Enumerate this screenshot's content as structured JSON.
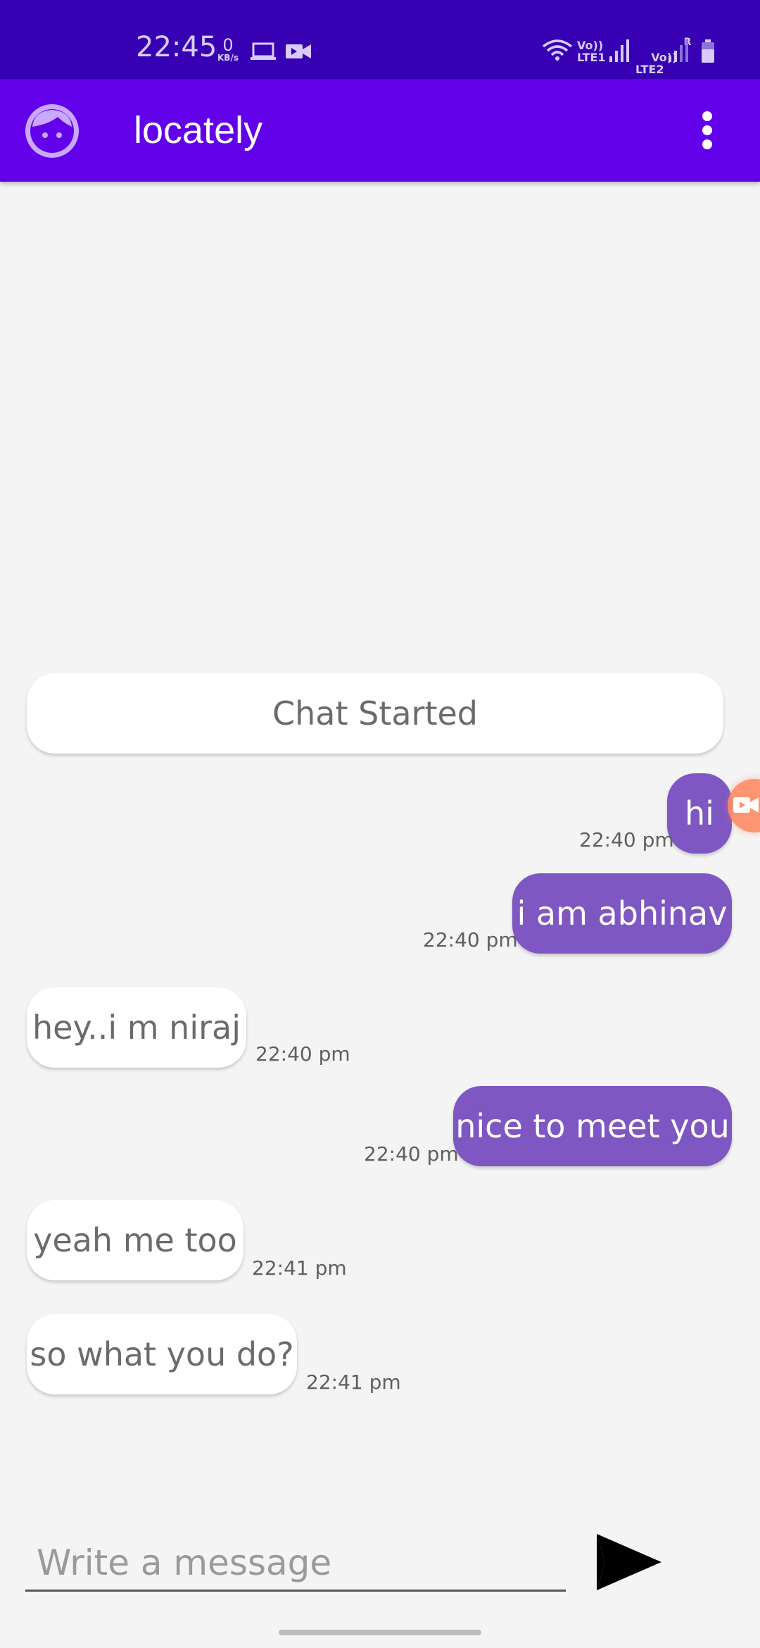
{
  "status_bar": {
    "time": "22:45",
    "net_speed": "0",
    "net_unit": "KB/s",
    "sim1": "Vo))\nLTE1",
    "sim2": "Vo))\nLTE2",
    "roaming": "R"
  },
  "app_bar": {
    "title": "locately",
    "avatar_icon": "face-icon",
    "menu_icon": "more-vert-icon"
  },
  "chat": {
    "banner": "Chat Started",
    "messages": [
      {
        "direction": "outgoing",
        "text": "hi",
        "time": "22:40 pm"
      },
      {
        "direction": "outgoing",
        "text": "i am abhinav",
        "time": "22:40 pm"
      },
      {
        "direction": "incoming",
        "text": "hey..i m niraj",
        "time": "22:40 pm"
      },
      {
        "direction": "outgoing",
        "text": "nice to meet you",
        "time": "22:40 pm"
      },
      {
        "direction": "incoming",
        "text": "yeah me too",
        "time": "22:41 pm"
      },
      {
        "direction": "incoming",
        "text": "so what you do?",
        "time": "22:41 pm"
      }
    ]
  },
  "composer": {
    "placeholder": "Write a message",
    "value": "",
    "send_icon": "send-icon"
  },
  "colors": {
    "status_bar": "#3700b3",
    "app_bar": "#6200ea",
    "outgoing_bubble": "#7e57c2",
    "incoming_bubble": "#ffffff",
    "background": "#f4f4f4"
  }
}
